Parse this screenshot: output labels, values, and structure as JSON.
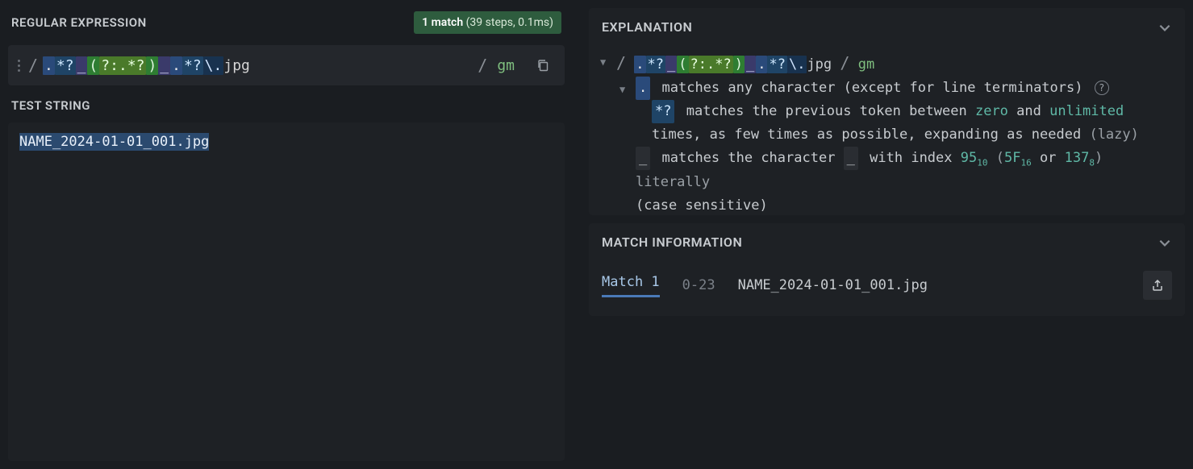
{
  "headers": {
    "regex": "REGULAR EXPRESSION",
    "test": "TEST STRING",
    "explanation": "EXPLANATION",
    "match_info": "MATCH INFORMATION"
  },
  "match_badge": {
    "count": "1 match",
    "details": "(39 steps, 0.1ms)"
  },
  "regex": {
    "open_delim": "/",
    "close_delim": "/",
    "flags": "gm",
    "tokens": [
      {
        "cls": "tk-meta",
        "t": "."
      },
      {
        "cls": "tk-quant",
        "t": "*?"
      },
      {
        "cls": "tk-lit",
        "t": "_"
      },
      {
        "cls": "tk-grp-open",
        "t": "("
      },
      {
        "cls": "tk-grp-body",
        "t": "?:.*?"
      },
      {
        "cls": "tk-grp-close",
        "t": ")"
      },
      {
        "cls": "tk-lit",
        "t": "_"
      },
      {
        "cls": "tk-meta",
        "t": "."
      },
      {
        "cls": "tk-quant",
        "t": "*?"
      },
      {
        "cls": "tk-esc",
        "t": "\\."
      },
      {
        "cls": "",
        "t": "jpg"
      }
    ]
  },
  "test_string": "NAME_2024-01-01_001.jpg",
  "explanation": {
    "regex_line": {
      "open": "/",
      "tokens": [
        {
          "cls": "tk-meta",
          "t": "."
        },
        {
          "cls": "tk-quant",
          "t": "*?"
        },
        {
          "cls": "tk-lit",
          "t": "_"
        },
        {
          "cls": "tk-grp-open",
          "t": "("
        },
        {
          "cls": "tk-grp-body",
          "t": "?:.*?"
        },
        {
          "cls": "tk-grp-close",
          "t": ")"
        },
        {
          "cls": "tk-lit",
          "t": "_"
        },
        {
          "cls": "tk-meta",
          "t": "."
        },
        {
          "cls": "tk-quant",
          "t": "*?"
        },
        {
          "cls": "tk-esc",
          "t": "\\."
        },
        {
          "cls": "",
          "t": "jpg"
        }
      ],
      "close": "/",
      "flags": "gm"
    },
    "line_dot": {
      "token": ".",
      "token_cls": "tk-meta",
      "text": "matches any character (except for line terminators)"
    },
    "line_star": {
      "token": "*?",
      "token_cls": "tk-quant",
      "pre": "matches the previous token between ",
      "zero": "zero",
      "and": " and ",
      "unlimited": "unlimited",
      "post1": "times, as few times as possible, expanding as needed ",
      "lazy": "(lazy)"
    },
    "line_underscore": {
      "token": "_",
      "pre": "matches the character ",
      "mid1": " with index ",
      "v1": "95",
      "s1": "10",
      "open": " (",
      "v2": "5F",
      "s2": "16",
      "or": " or ",
      "v3": "137",
      "s3": "8",
      "close": ") literally",
      "post": "(case sensitive)"
    }
  },
  "match": {
    "label": "Match 1",
    "range": "0-23",
    "text": "NAME_2024-01-01_001.jpg"
  }
}
